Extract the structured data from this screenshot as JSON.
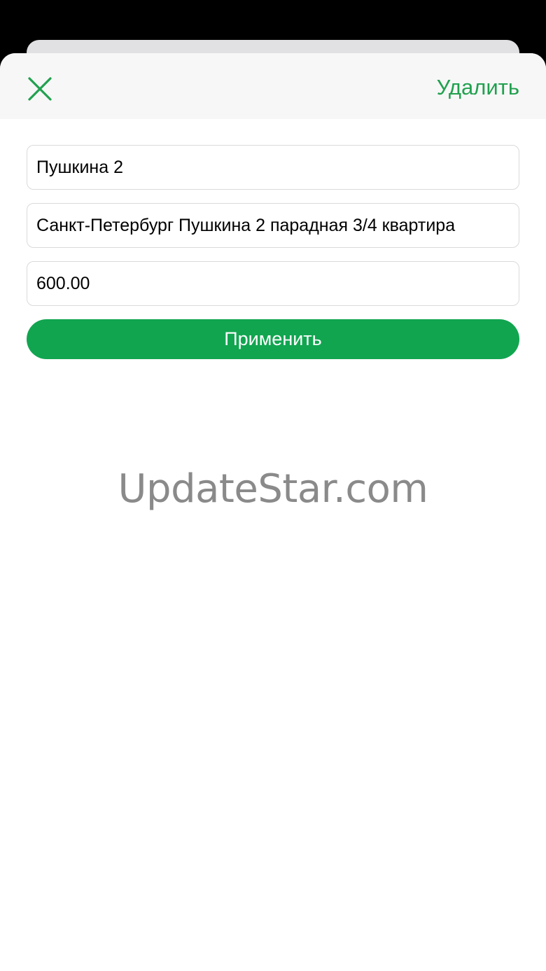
{
  "header": {
    "close_icon": "close-x-icon",
    "delete_label": "Удалить"
  },
  "form": {
    "name_value": "Пушкина 2",
    "address_value": "Санкт-Петербург Пушкина 2 парадная 3/4 квартира",
    "price_value": "600.00",
    "apply_label": "Применить"
  },
  "watermark": "UpdateStar.com",
  "colors": {
    "accent": "#21a14f",
    "button": "#11a550",
    "header_bg": "#f7f7f7",
    "border": "#dadada"
  }
}
